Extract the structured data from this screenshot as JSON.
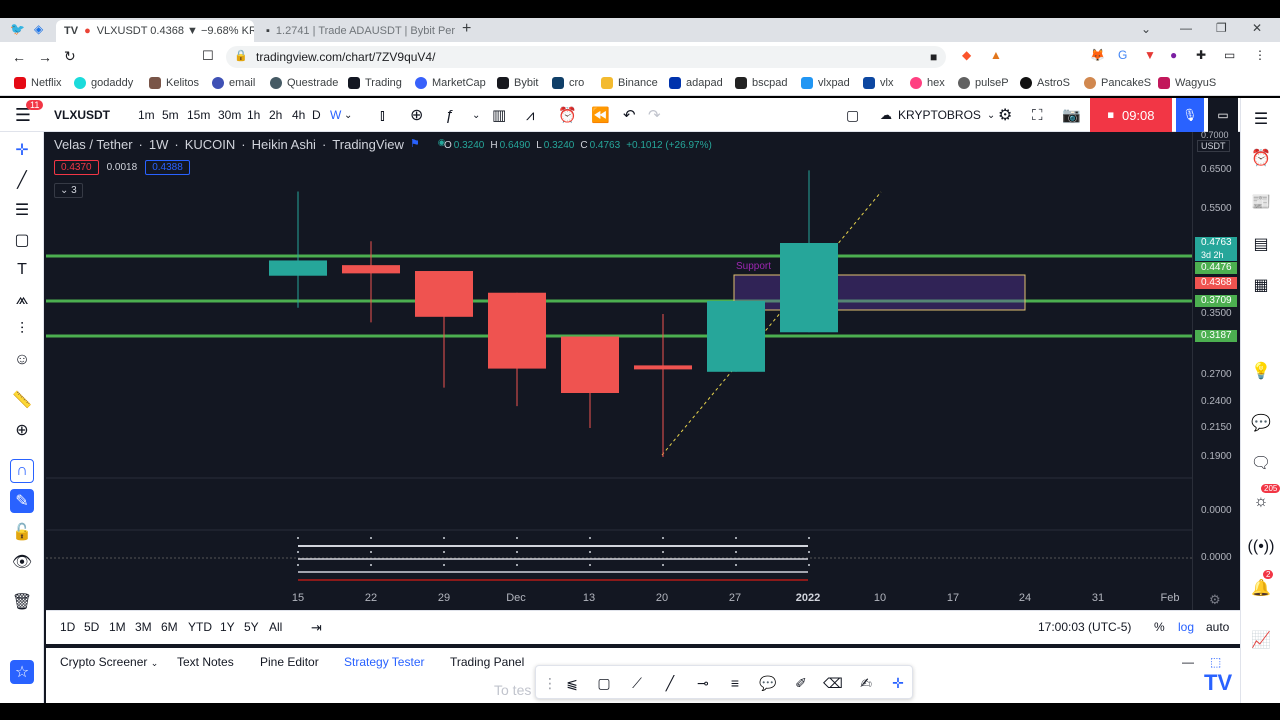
{
  "browser": {
    "tabs": [
      {
        "title": "VLXUSDT 0.4368 ▼ −9.68% KR",
        "active": true
      },
      {
        "title": "1.2741 | Trade ADAUSDT | Bybit Per",
        "active": false
      }
    ],
    "url": "tradingview.com/chart/7ZV9quV4/",
    "bookmarks": [
      "Netflix",
      "godaddy",
      "Kelitos",
      "email",
      "Questrade",
      "Trading",
      "MarketCap",
      "Bybit",
      "cro",
      "Binance",
      "adapad",
      "bscpad",
      "vlxpad",
      "vlx",
      "hex",
      "pulseP",
      "AstroS",
      "PancakeS",
      "WagyuS"
    ]
  },
  "toolbar": {
    "symbol": "VLXUSDT",
    "intervals": [
      "1m",
      "5m",
      "15m",
      "30m",
      "1h",
      "2h",
      "4h",
      "D",
      "W"
    ],
    "active_interval": "W",
    "layout_name": "KRYPTOBROS",
    "record_time": "09:08",
    "notif_badge": "11"
  },
  "legend": {
    "pair": "Velas / Tether",
    "interval": "1W",
    "exchange": "KUCOIN",
    "style": "Heikin Ashi",
    "source": "TradingView",
    "o_label": "O",
    "o": "0.3240",
    "h_label": "H",
    "h": "0.6490",
    "l_label": "L",
    "l": "0.3240",
    "c_label": "C",
    "c": "0.4763",
    "change": "+0.1012 (+26.97%)",
    "sell": "0.4370",
    "spread": "0.0018",
    "buy": "0.4388",
    "indicators_count": "3"
  },
  "price_axis": {
    "currency": "USDT",
    "labels": [
      "0.7000",
      "0.6500",
      "0.5500",
      "0.3500",
      "0.2700",
      "0.2400",
      "0.2150",
      "0.1900",
      "0.0000",
      "0.0000"
    ],
    "tags": [
      {
        "value": "0.4763",
        "color": "#26a69a"
      },
      {
        "value": "3d 2h",
        "color": "#26a69a"
      },
      {
        "value": "0.4476",
        "color": "#4caf50"
      },
      {
        "value": "0.4368",
        "color": "#ef5350"
      },
      {
        "value": "0.3709",
        "color": "#4caf50"
      },
      {
        "value": "0.3187",
        "color": "#4caf50"
      }
    ]
  },
  "time_axis": [
    "15",
    "22",
    "29",
    "Dec",
    "13",
    "20",
    "27",
    "2022",
    "10",
    "17",
    "24",
    "31",
    "Feb"
  ],
  "chart_data": {
    "type": "candlestick",
    "candles": [
      {
        "date": "2021-11-15",
        "open": 0.414,
        "high": 0.595,
        "low": 0.36,
        "close": 0.44,
        "color": "up"
      },
      {
        "date": "2021-11-22",
        "open": 0.432,
        "high": 0.48,
        "low": 0.338,
        "close": 0.418,
        "color": "down"
      },
      {
        "date": "2021-11-29",
        "open": 0.422,
        "high": 0.422,
        "low": 0.256,
        "close": 0.346,
        "color": "down"
      },
      {
        "date": "2021-12-06",
        "open": 0.385,
        "high": 0.385,
        "low": 0.236,
        "close": 0.278,
        "color": "down"
      },
      {
        "date": "2021-12-13",
        "open": 0.318,
        "high": 0.318,
        "low": 0.215,
        "close": 0.25,
        "color": "down"
      },
      {
        "date": "2021-12-20",
        "open": 0.282,
        "high": 0.35,
        "low": 0.19,
        "close": 0.277,
        "color": "down"
      },
      {
        "date": "2021-12-27",
        "open": 0.274,
        "high": 0.3709,
        "low": 0.274,
        "close": 0.3709,
        "color": "up"
      },
      {
        "date": "2022-01-03",
        "open": 0.324,
        "high": 0.649,
        "low": 0.324,
        "close": 0.4763,
        "color": "up"
      }
    ],
    "horizontal_lines": [
      0.4476,
      0.3709,
      0.3187
    ],
    "zone_label": "Support",
    "up_color": "#26a69a",
    "down_color": "#ef5350",
    "line_color": "#4caf50"
  },
  "range_bar": {
    "ranges": [
      "1D",
      "5D",
      "1M",
      "3M",
      "6M",
      "YTD",
      "1Y",
      "5Y",
      "All"
    ],
    "time": "17:00:03 (UTC-5)",
    "pct": "%",
    "log": "log",
    "auto": "auto"
  },
  "bottom_tabs": [
    "Crypto Screener",
    "Text Notes",
    "Pine Editor",
    "Strategy Tester",
    "Trading Panel"
  ],
  "active_bottom_tab": "Strategy Tester",
  "bottom_hint": "To tes",
  "right_badges": {
    "ideas": "205",
    "alerts": "2"
  }
}
